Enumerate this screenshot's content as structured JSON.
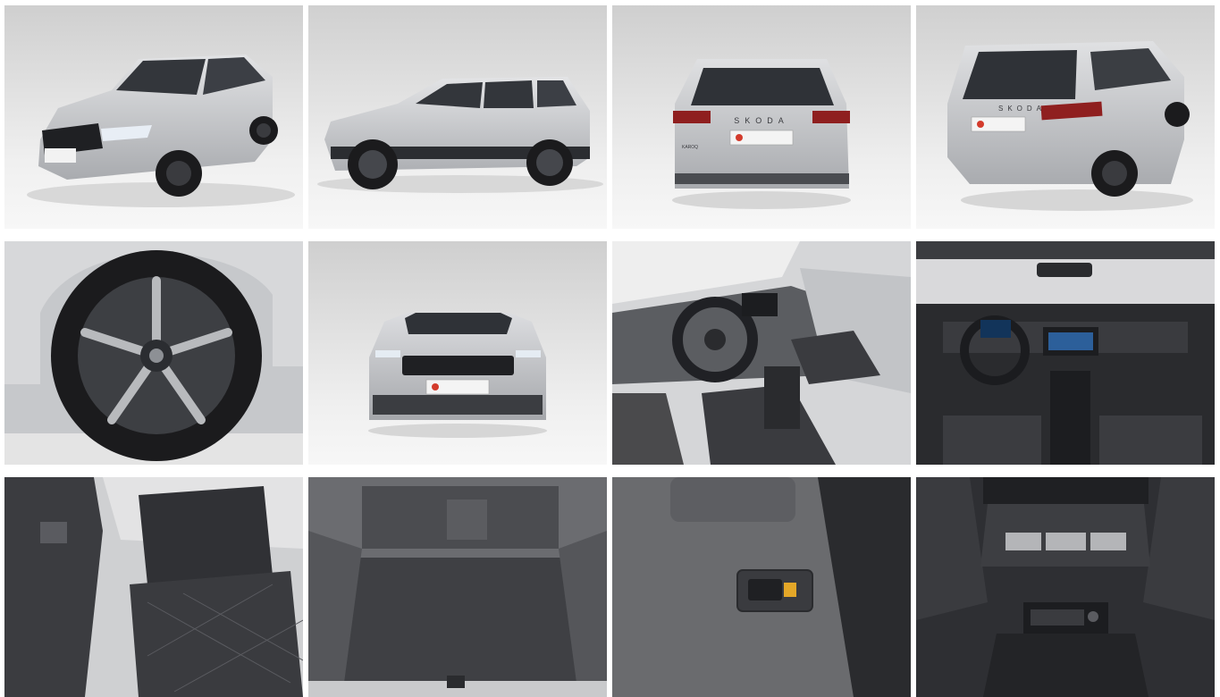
{
  "gallery": {
    "photos": [
      {
        "id": "front-three-quarter",
        "caption": ""
      },
      {
        "id": "side",
        "caption": ""
      },
      {
        "id": "rear",
        "caption": ""
      },
      {
        "id": "rear-three-quarter",
        "caption": ""
      },
      {
        "id": "wheel",
        "caption": ""
      },
      {
        "id": "front",
        "caption": ""
      },
      {
        "id": "driver-interior",
        "caption": ""
      },
      {
        "id": "dashboard",
        "caption": ""
      },
      {
        "id": "rear-seats",
        "caption": ""
      },
      {
        "id": "trunk",
        "caption": ""
      },
      {
        "id": "trunk-lever",
        "caption": ""
      },
      {
        "id": "rear-console",
        "caption": ""
      }
    ],
    "badge_text": "SKODA",
    "model_text": "KAROQ",
    "colors": {
      "studio_bg_top": "#cfcfcf",
      "studio_bg_bottom": "#f4f4f4",
      "car_silver": "#c3c5c8",
      "car_dark": "#2b2d31",
      "tire": "#1b1b1d",
      "interior_dark": "#2a2b2e",
      "upholstery": "#3a3b3f",
      "carpet": "#4a4a4c",
      "dealer_plate_accent": "#d33b2c"
    }
  }
}
